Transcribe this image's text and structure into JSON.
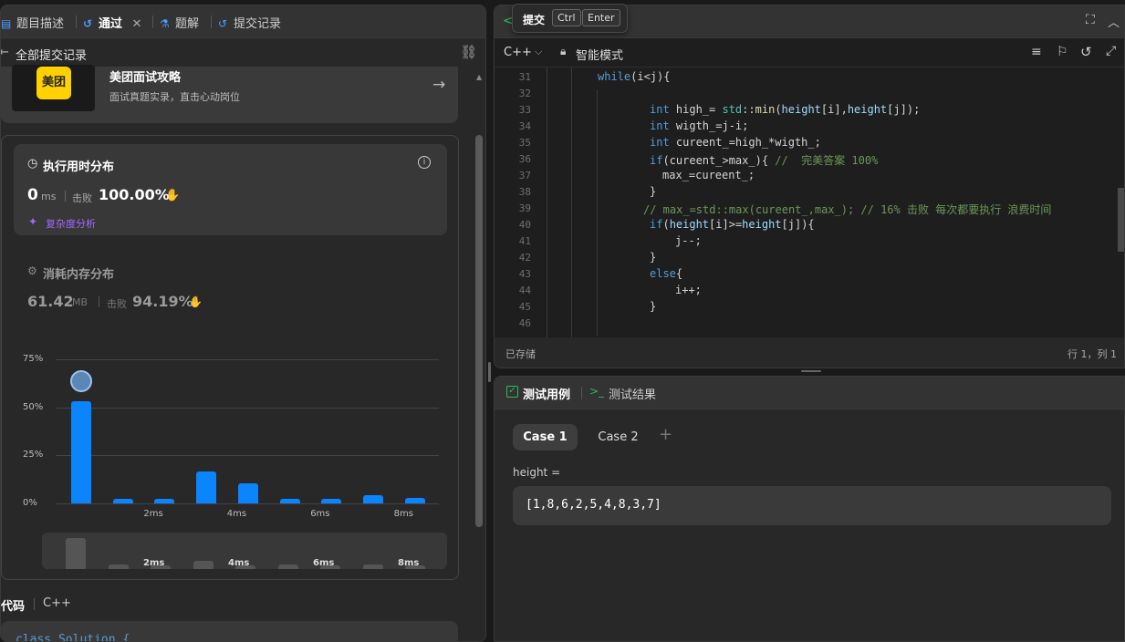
{
  "left_tabs": {
    "description": "题目描述",
    "passed": "通过",
    "solutions": "题解",
    "submissions": "提交记录"
  },
  "submission_header": {
    "back_label": "全部提交记录"
  },
  "promo": {
    "logo_text": "美团",
    "title": "美团面试攻略",
    "subtitle": "面试真题实录，直击心动岗位"
  },
  "runtime": {
    "title": "执行用时分布",
    "value": "0",
    "unit": "ms",
    "beat_label": "击败",
    "beat_value": "100.00%",
    "complexity_label": "复杂度分析"
  },
  "memory": {
    "title": "消耗内存分布",
    "value": "61.42",
    "unit": "MB",
    "beat_label": "击败",
    "beat_value": "94.19%"
  },
  "chart_data": {
    "type": "bar",
    "y_ticks": [
      "75%",
      "50%",
      "25%",
      "0%"
    ],
    "ylim": [
      0,
      75
    ],
    "x_ticks": [
      "2ms",
      "4ms",
      "6ms",
      "8ms"
    ],
    "values": [
      53,
      2.5,
      2.5,
      16.5,
      10.5,
      2.5,
      2.5,
      4.5,
      3
    ],
    "highlight_index": 0,
    "grid": true
  },
  "mini_chart": {
    "values": [
      30,
      4,
      0,
      8,
      0,
      4,
      0,
      4,
      0
    ],
    "x_ticks": [
      "2ms",
      "4ms",
      "6ms",
      "8ms"
    ]
  },
  "code_section": {
    "label": "代码",
    "lang": "C++",
    "first_line": "class Solution {"
  },
  "editor": {
    "submit_label": "提交",
    "key1": "Ctrl",
    "key2": "Enter",
    "lang": "C++",
    "mode": "智能模式",
    "status": "已存储",
    "cursor": "行 1，列 1",
    "lines": [
      {
        "n": "31",
        "t": "while(i<j){"
      },
      {
        "n": "32",
        "t": ""
      },
      {
        "n": "33",
        "t": "int high_= std::min(height[i],height[j]);"
      },
      {
        "n": "34",
        "t": "int wigth_=j-i;"
      },
      {
        "n": "35",
        "t": "int cureent_=high_*wigth_;"
      },
      {
        "n": "36",
        "t": "if(cureent_>max_){ //  完美答案 100%"
      },
      {
        "n": "37",
        "t": "max_=cureent_;"
      },
      {
        "n": "38",
        "t": "}"
      },
      {
        "n": "39",
        "t": "// max_=std::max(cureent_,max_); // 16% 击败 每次都要执行 浪费时间"
      },
      {
        "n": "40",
        "t": "if(height[i]>=height[j]){"
      },
      {
        "n": "41",
        "t": "j--;"
      },
      {
        "n": "42",
        "t": "}"
      },
      {
        "n": "43",
        "t": "else{"
      },
      {
        "n": "44",
        "t": "i++;"
      },
      {
        "n": "45",
        "t": "}"
      },
      {
        "n": "46",
        "t": ""
      }
    ]
  },
  "testcase": {
    "tab1": "测试用例",
    "tab2": "测试结果",
    "case1": "Case 1",
    "case2": "Case 2",
    "add": "+",
    "param_label": "height =",
    "param_value": "[1,8,6,2,5,4,8,3,7]"
  },
  "colors": {
    "accent_blue": "#0a84ff",
    "green": "#2cbb5d",
    "purple": "#a06bff"
  }
}
